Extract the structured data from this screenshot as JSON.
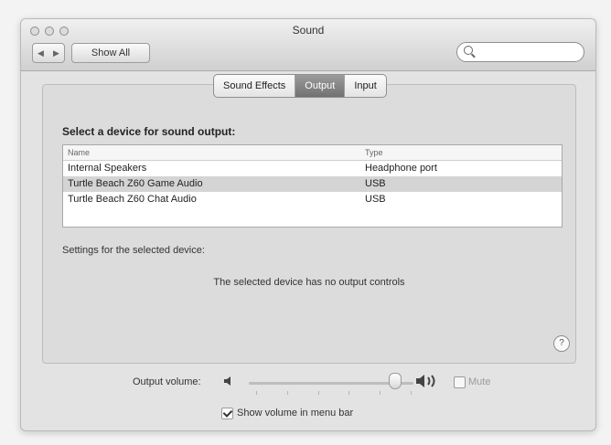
{
  "window": {
    "title": "Sound",
    "nav": {
      "back_icon": "chevron-left-icon",
      "forward_icon": "chevron-right-icon",
      "show_all_label": "Show All"
    },
    "search": {
      "icon": "search-icon",
      "placeholder": ""
    }
  },
  "tabs": [
    {
      "label": "Sound Effects",
      "active": false
    },
    {
      "label": "Output",
      "active": true
    },
    {
      "label": "Input",
      "active": false
    }
  ],
  "output": {
    "section_title": "Select a device for sound output:",
    "columns": [
      "Name",
      "Type"
    ],
    "devices": [
      {
        "name": "Internal Speakers",
        "type": "Headphone port",
        "selected": false
      },
      {
        "name": "Turtle Beach Z60 Game Audio",
        "type": "USB",
        "selected": true
      },
      {
        "name": "Turtle Beach Z60 Chat Audio",
        "type": "USB",
        "selected": false
      }
    ],
    "settings_label": "Settings for the selected device:",
    "no_controls_message": "The selected device has no output controls",
    "help_label": "?"
  },
  "volume": {
    "label": "Output volume:",
    "level_percent": 92,
    "mute_label": "Mute",
    "mute_checked": false
  },
  "menu_bar": {
    "show_volume_label": "Show volume in menu bar",
    "checked": true
  }
}
